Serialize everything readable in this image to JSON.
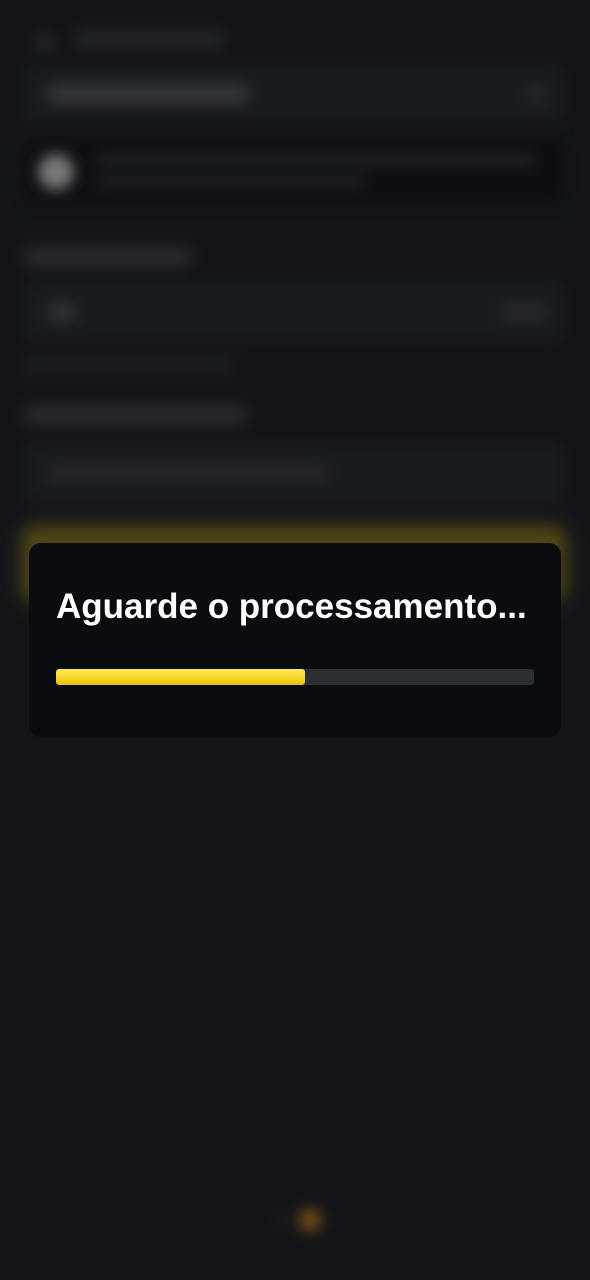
{
  "modal": {
    "title": "Aguarde o processamento...",
    "progress": 0.52
  },
  "colors": {
    "background": "#16181c",
    "modal_background": "#0b0c0f",
    "progress_fill": "#f5d524",
    "progress_track": "#2b2e33",
    "title_text": "#ffffff"
  }
}
